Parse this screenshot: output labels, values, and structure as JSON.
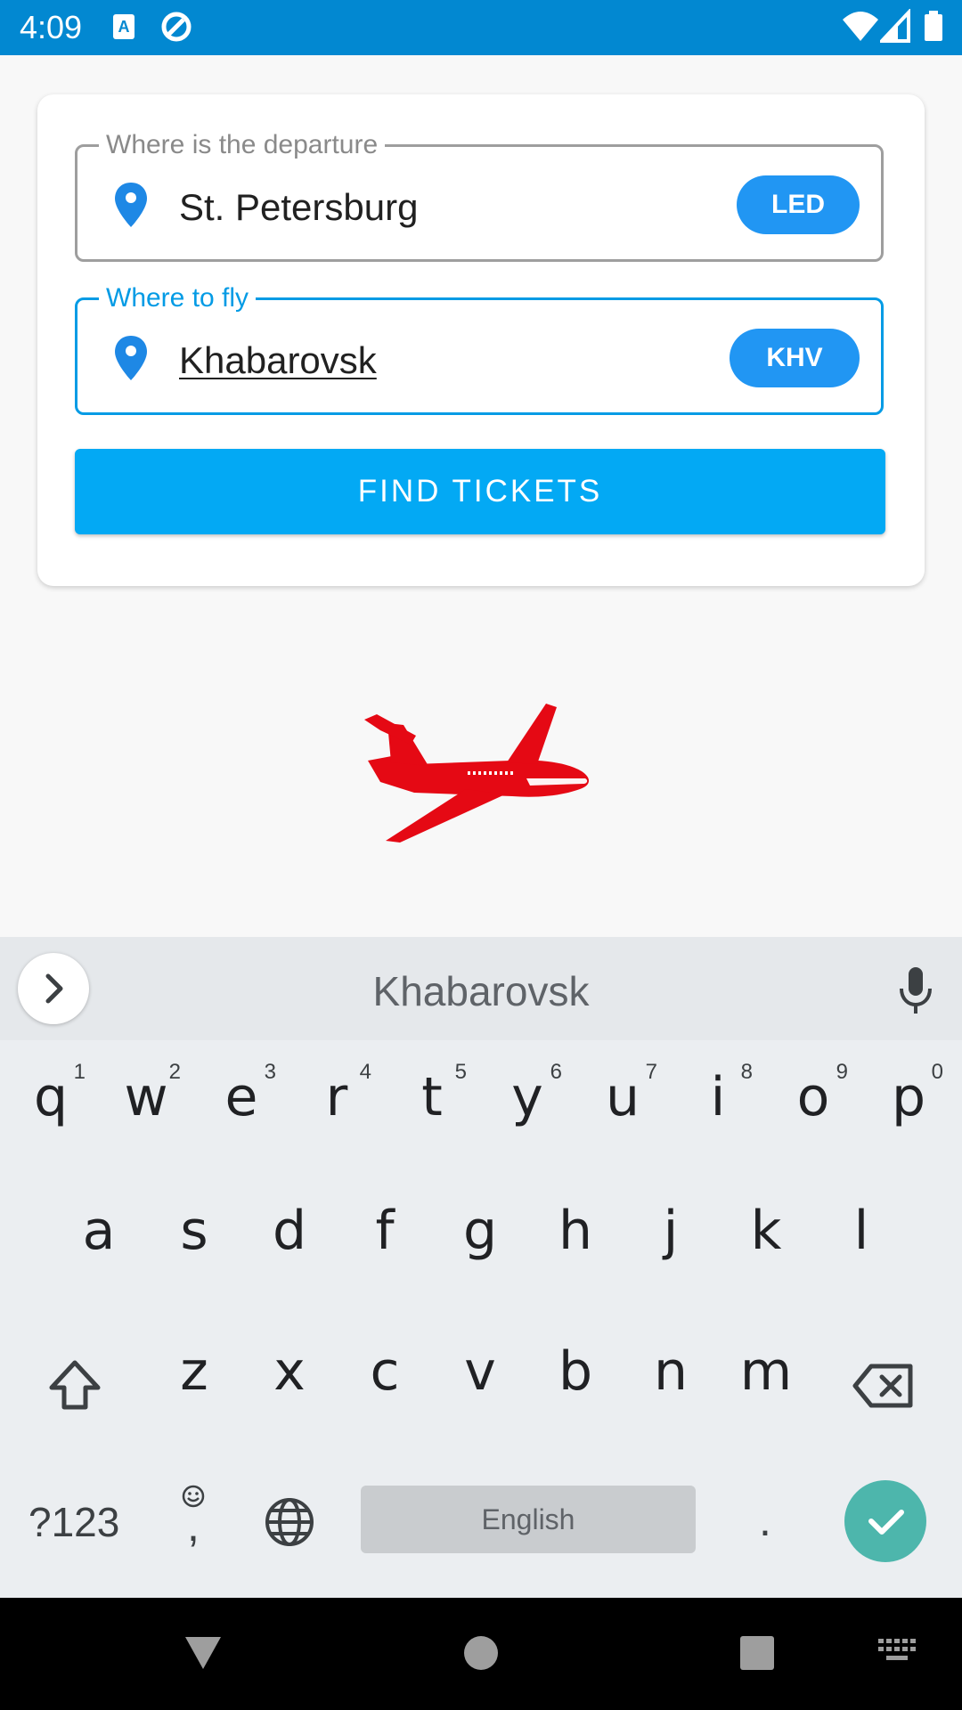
{
  "status_bar": {
    "time": "4:09"
  },
  "search_form": {
    "departure": {
      "label": "Where is the departure",
      "value": "St. Petersburg",
      "code": "LED"
    },
    "destination": {
      "label": "Where to fly",
      "value": "Khabarovsk",
      "code": "KHV"
    },
    "find_button_label": "FIND TICKETS"
  },
  "keyboard": {
    "suggestion": "Khabarovsk",
    "row1": [
      {
        "key": "q",
        "hint": "1"
      },
      {
        "key": "w",
        "hint": "2"
      },
      {
        "key": "e",
        "hint": "3"
      },
      {
        "key": "r",
        "hint": "4"
      },
      {
        "key": "t",
        "hint": "5"
      },
      {
        "key": "y",
        "hint": "6"
      },
      {
        "key": "u",
        "hint": "7"
      },
      {
        "key": "i",
        "hint": "8"
      },
      {
        "key": "o",
        "hint": "9"
      },
      {
        "key": "p",
        "hint": "0"
      }
    ],
    "row2": [
      "a",
      "s",
      "d",
      "f",
      "g",
      "h",
      "j",
      "k",
      "l"
    ],
    "row3": [
      "z",
      "x",
      "c",
      "v",
      "b",
      "n",
      "m"
    ],
    "symbols_label": "?123",
    "comma_label": ",",
    "space_label": "English",
    "period_label": "."
  },
  "colors": {
    "accent": "#039be5",
    "button": "#03a9f4",
    "chip": "#2196f3",
    "plane": "#e50914",
    "done": "#4db6ac"
  }
}
